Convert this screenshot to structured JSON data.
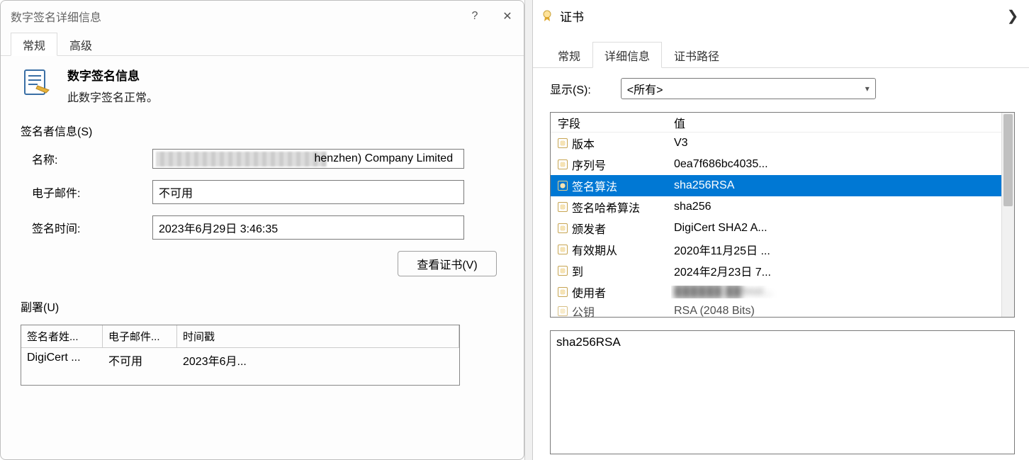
{
  "left": {
    "title": "数字签名详细信息",
    "tabs": {
      "general": "常规",
      "advanced": "高级"
    },
    "header_title": "数字签名信息",
    "header_sub": "此数字签名正常。",
    "signer_group": "签名者信息(S)",
    "name_label": "名称:",
    "name_value": "henzhen) Company Limited",
    "email_label": "电子邮件:",
    "email_value": "不可用",
    "time_label": "签名时间:",
    "time_value": "2023年6月29日 3:46:35",
    "view_cert_btn": "查看证书(V)",
    "counter_group": "副署(U)",
    "counter_cols": {
      "c0": "签名者姓...",
      "c1": "电子邮件...",
      "c2": "时间戳"
    },
    "counter_row": {
      "c0": "DigiCert ...",
      "c1": "不可用",
      "c2": "2023年6月..."
    }
  },
  "right": {
    "title": "证书",
    "tabs": {
      "general": "常规",
      "details": "详细信息",
      "path": "证书路径"
    },
    "show_label": "显示(S):",
    "show_value": "<所有>",
    "col_field": "字段",
    "col_value": "值",
    "rows": [
      {
        "f": "版本",
        "v": "V3"
      },
      {
        "f": "序列号",
        "v": "0ea7f686bc4035..."
      },
      {
        "f": "签名算法",
        "v": "sha256RSA"
      },
      {
        "f": "签名哈希算法",
        "v": "sha256"
      },
      {
        "f": "颁发者",
        "v": "DigiCert SHA2 A..."
      },
      {
        "f": "有效期从",
        "v": "2020年11月25日 ..."
      },
      {
        "f": "到",
        "v": "2024年2月23日 7..."
      },
      {
        "f": "使用者",
        "v": "██████ ██hnol..."
      },
      {
        "f": "公钥",
        "v": "RSA (2048 Bits)"
      }
    ],
    "selected_index": 2,
    "blur_index": 7,
    "detail_value": "sha256RSA"
  }
}
